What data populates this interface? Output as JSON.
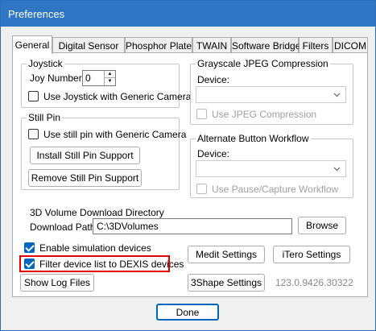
{
  "window": {
    "title": "Preferences"
  },
  "tabs": [
    {
      "label": "General",
      "active": true
    },
    {
      "label": "Digital Sensor"
    },
    {
      "label": "Phosphor Plate"
    },
    {
      "label": "TWAIN"
    },
    {
      "label": "Software Bridge"
    },
    {
      "label": "Filters"
    },
    {
      "label": "DICOM"
    }
  ],
  "joystick": {
    "group_label": "Joystick",
    "joy_number_label": "Joy Number",
    "joy_number_value": "0",
    "generic_camera_label": "Use Joystick with Generic Camera",
    "generic_camera_checked": false
  },
  "still_pin": {
    "group_label": "Still Pin",
    "generic_camera_label": "Use still pin with Generic Camera",
    "generic_camera_checked": false,
    "install_button": "Install Still Pin Support",
    "remove_button": "Remove Still Pin Support"
  },
  "jpeg": {
    "group_label": "Grayscale JPEG Compression",
    "device_label": "Device:",
    "device_value": "",
    "use_compression_label": "Use JPEG Compression",
    "use_compression_checked": false
  },
  "alt_workflow": {
    "group_label": "Alternate Button Workflow",
    "device_label": "Device:",
    "device_value": "",
    "pause_capture_label": "Use Pause/Capture Workflow",
    "pause_capture_checked": false
  },
  "volume": {
    "group_label": "3D Volume Download Directory",
    "path_label": "Download Path",
    "path_value": "C:\\3DVolumes",
    "browse_button": "Browse"
  },
  "options": {
    "simulation_label": "Enable simulation devices",
    "simulation_checked": true,
    "filter_label": "Filter device list to DEXIS devices",
    "filter_checked": true
  },
  "buttons": {
    "medit": "Medit Settings",
    "itero": "iTero Settings",
    "show_log": "Show Log Files",
    "shape3": "3Shape Settings",
    "done": "Done"
  },
  "version": "123.0.9426.30322",
  "colors": {
    "accent": "#0067c0",
    "titlebar": "#2f76c4",
    "highlight": "#e00000"
  }
}
